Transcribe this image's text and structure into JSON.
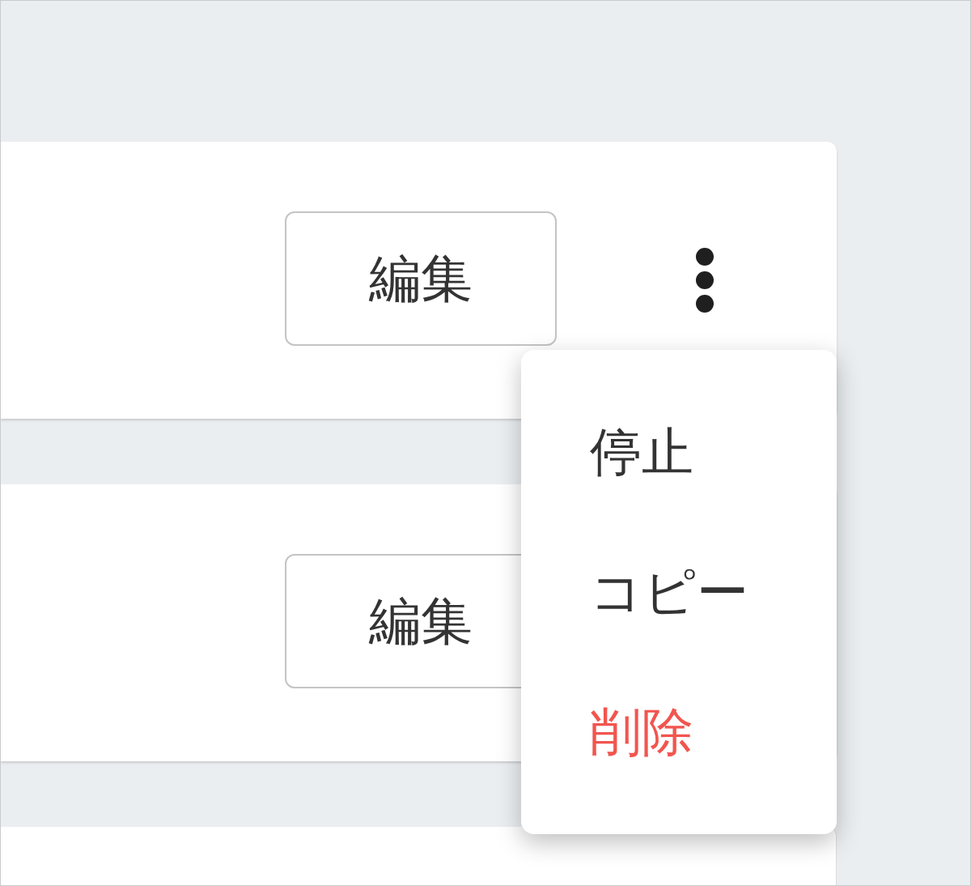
{
  "cards": [
    {
      "kind": "full",
      "edit_label": "編集",
      "menu": {
        "items": [
          {
            "label": "停止",
            "kind": "normal"
          },
          {
            "label": "コピー",
            "kind": "normal"
          },
          {
            "label": "削除",
            "kind": "danger"
          }
        ]
      }
    },
    {
      "kind": "full",
      "edit_label": "編集"
    },
    {
      "kind": "partial"
    }
  ]
}
